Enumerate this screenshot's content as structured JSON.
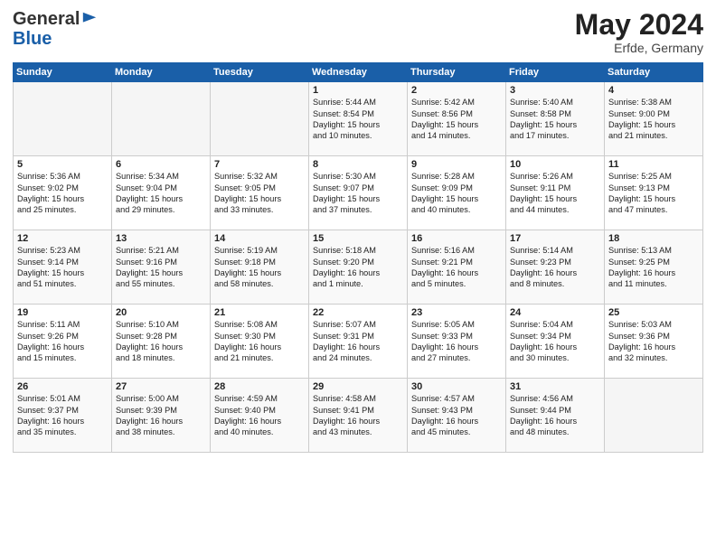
{
  "header": {
    "logo_line1": "General",
    "logo_line2": "Blue",
    "month_year": "May 2024",
    "location": "Erfde, Germany"
  },
  "days_of_week": [
    "Sunday",
    "Monday",
    "Tuesday",
    "Wednesday",
    "Thursday",
    "Friday",
    "Saturday"
  ],
  "weeks": [
    [
      {
        "day": "",
        "info": ""
      },
      {
        "day": "",
        "info": ""
      },
      {
        "day": "",
        "info": ""
      },
      {
        "day": "1",
        "info": "Sunrise: 5:44 AM\nSunset: 8:54 PM\nDaylight: 15 hours\nand 10 minutes."
      },
      {
        "day": "2",
        "info": "Sunrise: 5:42 AM\nSunset: 8:56 PM\nDaylight: 15 hours\nand 14 minutes."
      },
      {
        "day": "3",
        "info": "Sunrise: 5:40 AM\nSunset: 8:58 PM\nDaylight: 15 hours\nand 17 minutes."
      },
      {
        "day": "4",
        "info": "Sunrise: 5:38 AM\nSunset: 9:00 PM\nDaylight: 15 hours\nand 21 minutes."
      }
    ],
    [
      {
        "day": "5",
        "info": "Sunrise: 5:36 AM\nSunset: 9:02 PM\nDaylight: 15 hours\nand 25 minutes."
      },
      {
        "day": "6",
        "info": "Sunrise: 5:34 AM\nSunset: 9:04 PM\nDaylight: 15 hours\nand 29 minutes."
      },
      {
        "day": "7",
        "info": "Sunrise: 5:32 AM\nSunset: 9:05 PM\nDaylight: 15 hours\nand 33 minutes."
      },
      {
        "day": "8",
        "info": "Sunrise: 5:30 AM\nSunset: 9:07 PM\nDaylight: 15 hours\nand 37 minutes."
      },
      {
        "day": "9",
        "info": "Sunrise: 5:28 AM\nSunset: 9:09 PM\nDaylight: 15 hours\nand 40 minutes."
      },
      {
        "day": "10",
        "info": "Sunrise: 5:26 AM\nSunset: 9:11 PM\nDaylight: 15 hours\nand 44 minutes."
      },
      {
        "day": "11",
        "info": "Sunrise: 5:25 AM\nSunset: 9:13 PM\nDaylight: 15 hours\nand 47 minutes."
      }
    ],
    [
      {
        "day": "12",
        "info": "Sunrise: 5:23 AM\nSunset: 9:14 PM\nDaylight: 15 hours\nand 51 minutes."
      },
      {
        "day": "13",
        "info": "Sunrise: 5:21 AM\nSunset: 9:16 PM\nDaylight: 15 hours\nand 55 minutes."
      },
      {
        "day": "14",
        "info": "Sunrise: 5:19 AM\nSunset: 9:18 PM\nDaylight: 15 hours\nand 58 minutes."
      },
      {
        "day": "15",
        "info": "Sunrise: 5:18 AM\nSunset: 9:20 PM\nDaylight: 16 hours\nand 1 minute."
      },
      {
        "day": "16",
        "info": "Sunrise: 5:16 AM\nSunset: 9:21 PM\nDaylight: 16 hours\nand 5 minutes."
      },
      {
        "day": "17",
        "info": "Sunrise: 5:14 AM\nSunset: 9:23 PM\nDaylight: 16 hours\nand 8 minutes."
      },
      {
        "day": "18",
        "info": "Sunrise: 5:13 AM\nSunset: 9:25 PM\nDaylight: 16 hours\nand 11 minutes."
      }
    ],
    [
      {
        "day": "19",
        "info": "Sunrise: 5:11 AM\nSunset: 9:26 PM\nDaylight: 16 hours\nand 15 minutes."
      },
      {
        "day": "20",
        "info": "Sunrise: 5:10 AM\nSunset: 9:28 PM\nDaylight: 16 hours\nand 18 minutes."
      },
      {
        "day": "21",
        "info": "Sunrise: 5:08 AM\nSunset: 9:30 PM\nDaylight: 16 hours\nand 21 minutes."
      },
      {
        "day": "22",
        "info": "Sunrise: 5:07 AM\nSunset: 9:31 PM\nDaylight: 16 hours\nand 24 minutes."
      },
      {
        "day": "23",
        "info": "Sunrise: 5:05 AM\nSunset: 9:33 PM\nDaylight: 16 hours\nand 27 minutes."
      },
      {
        "day": "24",
        "info": "Sunrise: 5:04 AM\nSunset: 9:34 PM\nDaylight: 16 hours\nand 30 minutes."
      },
      {
        "day": "25",
        "info": "Sunrise: 5:03 AM\nSunset: 9:36 PM\nDaylight: 16 hours\nand 32 minutes."
      }
    ],
    [
      {
        "day": "26",
        "info": "Sunrise: 5:01 AM\nSunset: 9:37 PM\nDaylight: 16 hours\nand 35 minutes."
      },
      {
        "day": "27",
        "info": "Sunrise: 5:00 AM\nSunset: 9:39 PM\nDaylight: 16 hours\nand 38 minutes."
      },
      {
        "day": "28",
        "info": "Sunrise: 4:59 AM\nSunset: 9:40 PM\nDaylight: 16 hours\nand 40 minutes."
      },
      {
        "day": "29",
        "info": "Sunrise: 4:58 AM\nSunset: 9:41 PM\nDaylight: 16 hours\nand 43 minutes."
      },
      {
        "day": "30",
        "info": "Sunrise: 4:57 AM\nSunset: 9:43 PM\nDaylight: 16 hours\nand 45 minutes."
      },
      {
        "day": "31",
        "info": "Sunrise: 4:56 AM\nSunset: 9:44 PM\nDaylight: 16 hours\nand 48 minutes."
      },
      {
        "day": "",
        "info": ""
      }
    ]
  ]
}
